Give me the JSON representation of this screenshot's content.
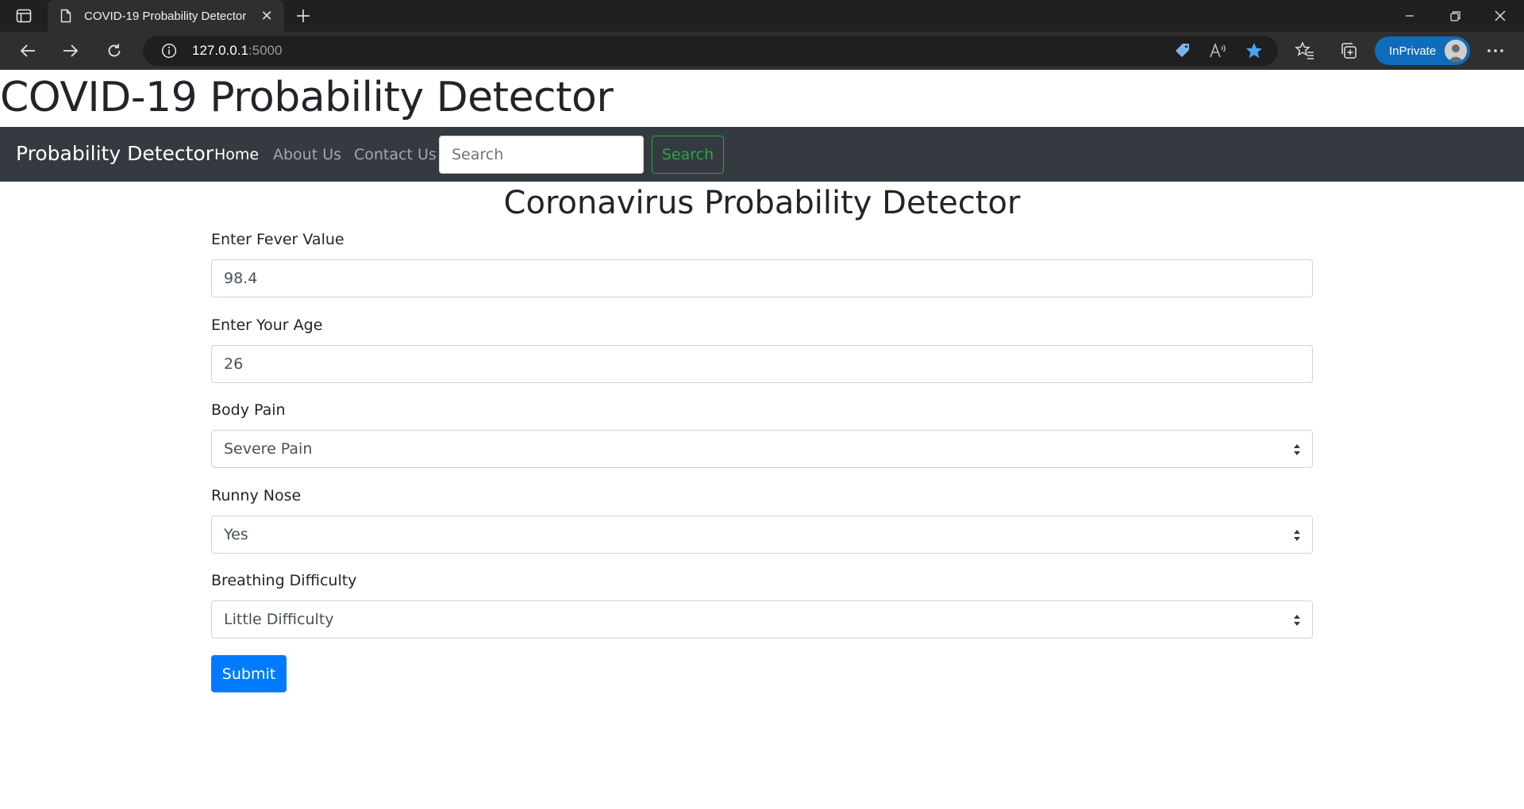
{
  "browser": {
    "tab_title": "COVID-19 Probability Detector",
    "address_host": "127.0.0.1",
    "address_port": ":5000",
    "inprivate_label": "InPrivate",
    "accent_color": "#0f6cbd"
  },
  "page": {
    "heading": "COVID-19 Probability Detector"
  },
  "navbar": {
    "brand": "Probability Detector",
    "links": [
      "Home",
      "About Us",
      "Contact Us"
    ],
    "active_link": "Home",
    "search_placeholder": "Search",
    "search_button": "Search",
    "background_color": "#343a40",
    "search_button_color": "#28a745"
  },
  "form": {
    "title": "Coronavirus Probability Detector",
    "fields": [
      {
        "label": "Enter Fever Value",
        "type": "input",
        "value": "98.4"
      },
      {
        "label": "Enter Your Age",
        "type": "input",
        "value": "26"
      },
      {
        "label": "Body Pain",
        "type": "select",
        "value": "Severe Pain"
      },
      {
        "label": "Runny Nose",
        "type": "select",
        "value": "Yes"
      },
      {
        "label": "Breathing Difficulty",
        "type": "select",
        "value": "Little Difficulty"
      }
    ],
    "submit_label": "Submit",
    "submit_color": "#007bff"
  }
}
